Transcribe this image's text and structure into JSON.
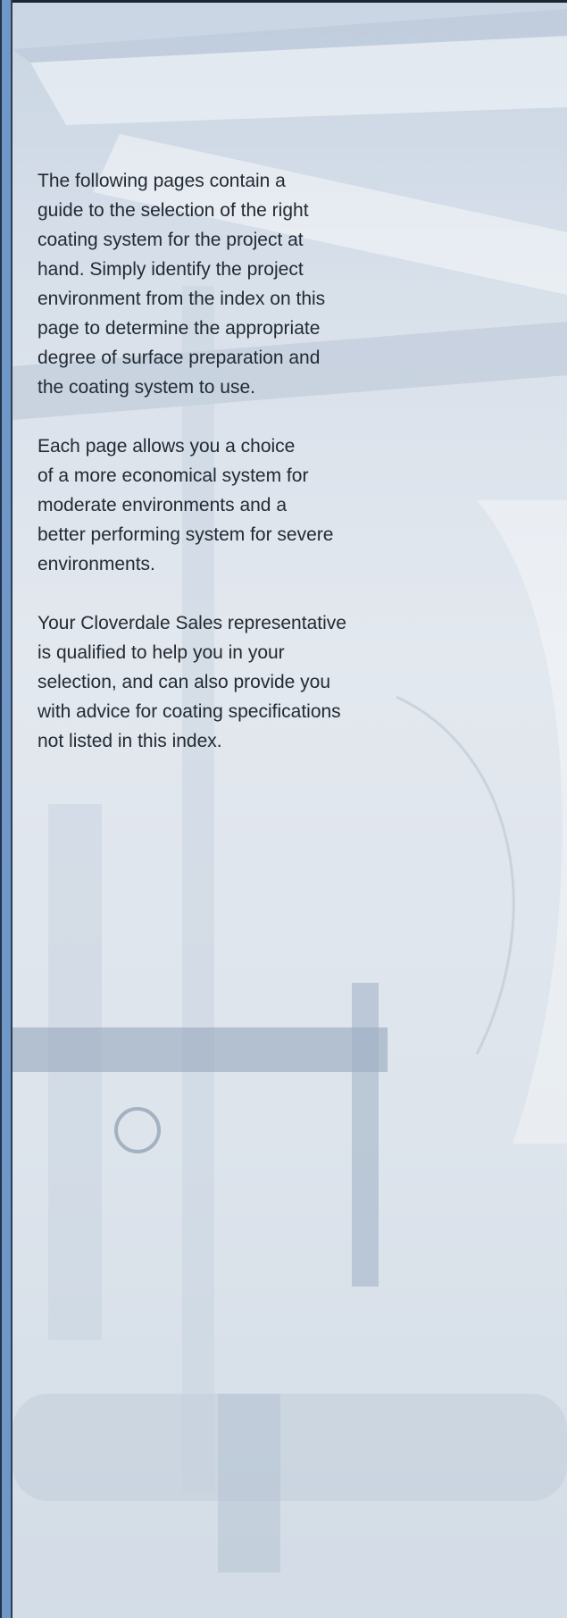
{
  "intro": {
    "paragraphs": [
      "The following pages contain a\nguide to the selection of the right\ncoating system for the project at\nhand. Simply identify the project\nenvironment from the index on this\npage to determine the appropriate\ndegree of surface preparation and\nthe coating system to use.",
      "Each page allows you a choice\nof a more economical system for\nmoderate environments and a\nbetter performing system for severe\nenvironments.",
      "Your Cloverdale Sales representative\nis qualified to help you in your\nselection, and can also provide you\nwith advice for coating specifications\nnot listed in this index."
    ]
  },
  "colors": {
    "accent_rail": "#6f97c8",
    "text": "#222a33",
    "background_tint": "#dfe6ee"
  }
}
